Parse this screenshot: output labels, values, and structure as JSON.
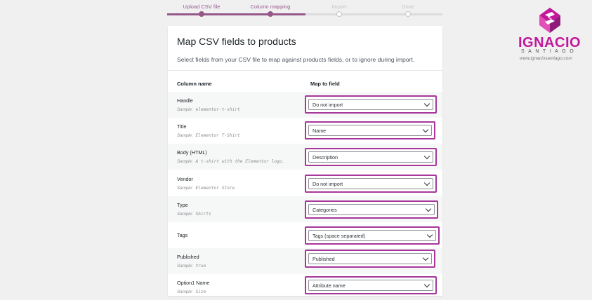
{
  "steps": [
    {
      "label": "Upload CSV file",
      "state": "done"
    },
    {
      "label": "Column mapping",
      "state": "active"
    },
    {
      "label": "Import",
      "state": "pending"
    },
    {
      "label": "Done",
      "state": "pending"
    }
  ],
  "card": {
    "title": "Map CSV fields to products",
    "description": "Select fields from your CSV file to map against products fields, or to ignore during import.",
    "col_name_header": "Column name",
    "col_map_header": "Map to field"
  },
  "rows": [
    {
      "name": "Handle",
      "sample_prefix": "Sample:",
      "sample": "elementor-t-shirt",
      "field": "Do not import"
    },
    {
      "name": "Title",
      "sample_prefix": "Sample:",
      "sample": "Elementor T-Shirt",
      "field": "Name"
    },
    {
      "name": "Body (HTML)",
      "sample_prefix": "Sample:",
      "sample": "A t-shirt with the Elementor logo.",
      "field": "Description"
    },
    {
      "name": "Vendor",
      "sample_prefix": "Sample:",
      "sample": "Elementor Store",
      "field": "Do not import"
    },
    {
      "name": "Type",
      "sample_prefix": "Sample:",
      "sample": "Shirts",
      "field": "Categories"
    },
    {
      "name": "Tags",
      "sample_prefix": "",
      "sample": "",
      "field": "Tags (space separated)"
    },
    {
      "name": "Published",
      "sample_prefix": "Sample:",
      "sample": "true",
      "field": "Published"
    },
    {
      "name": "Option1 Name",
      "sample_prefix": "Sample:",
      "sample": "Size",
      "field": "Attribute name"
    }
  ],
  "logo": {
    "wordmark": "IGNACIO",
    "sub": "SANTIAGO",
    "site": "www.ignaciosantiago.com",
    "brand_color": "#c2189b",
    "icon": "logo-s-mark-icon"
  },
  "colors": {
    "accent": "#96588a",
    "highlight": "#a7379a"
  }
}
